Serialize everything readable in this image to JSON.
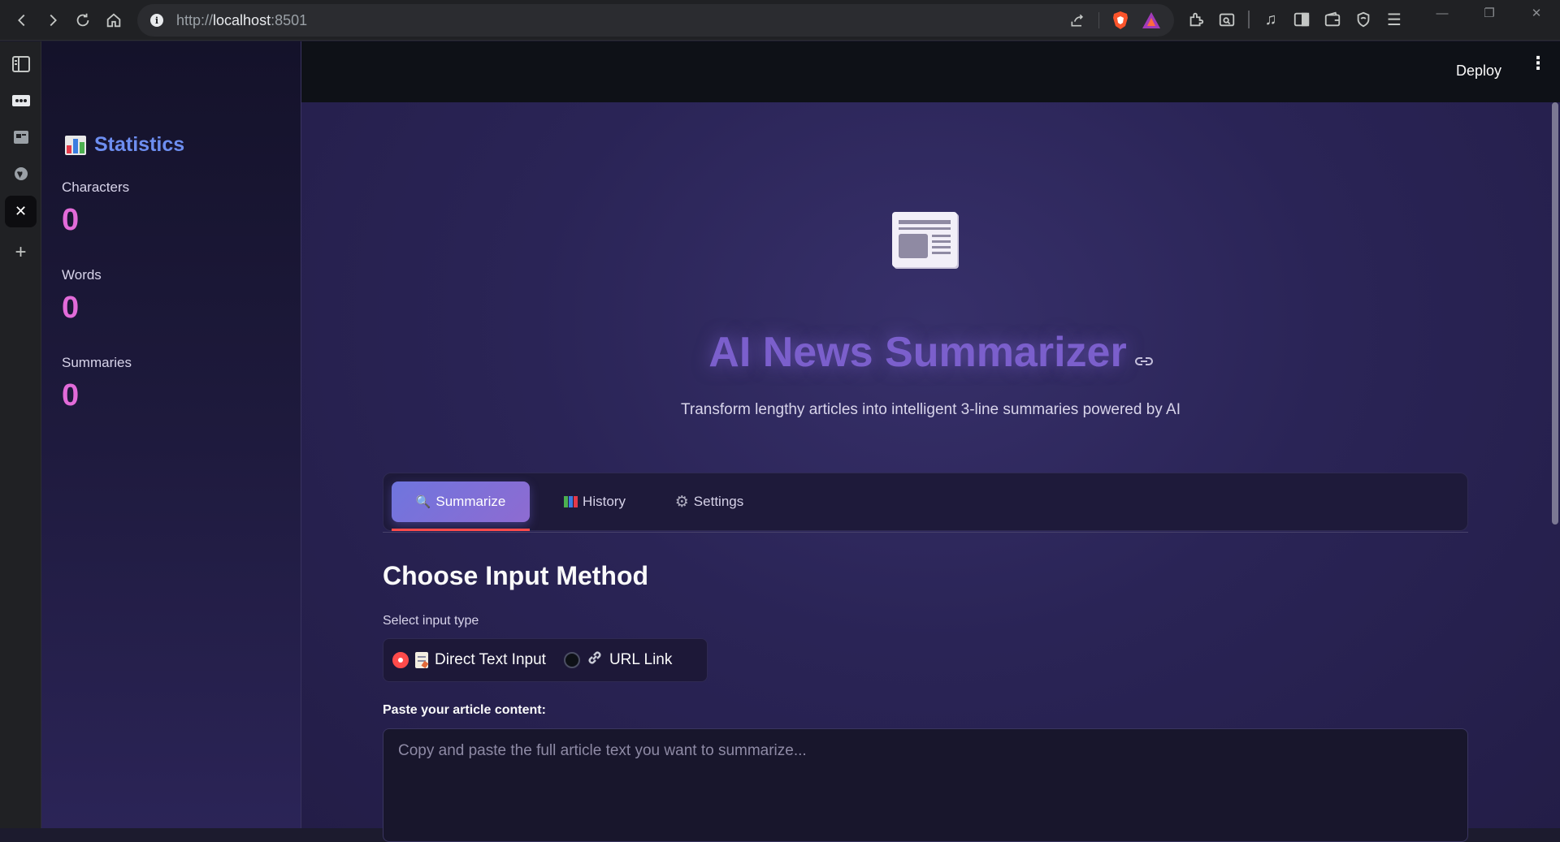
{
  "browser": {
    "url_scheme": "http://",
    "url_host": "localhost",
    "url_port": ":8501"
  },
  "sidebar": {
    "stats_title": "Statistics",
    "metrics": [
      {
        "label": "Characters",
        "value": "0"
      },
      {
        "label": "Words",
        "value": "0"
      },
      {
        "label": "Summaries",
        "value": "0"
      }
    ]
  },
  "header": {
    "deploy_label": "Deploy",
    "menu_glyph": "⋮"
  },
  "hero": {
    "title": "AI News Summarizer",
    "subtitle": "Transform lengthy articles into intelligent 3-line summaries powered by AI"
  },
  "tabs": [
    {
      "label": "Summarize",
      "icon": "magnifier-icon",
      "active": true
    },
    {
      "label": "History",
      "icon": "books-icon",
      "active": false
    },
    {
      "label": "Settings",
      "icon": "gear-icon",
      "active": false
    }
  ],
  "input": {
    "section_title": "Choose Input Method",
    "select_label": "Select input type",
    "options": [
      {
        "label": "Direct Text Input",
        "icon": "memo-icon",
        "checked": true
      },
      {
        "label": "URL Link",
        "icon": "link-icon",
        "checked": false
      }
    ],
    "paste_label": "Paste your article content:",
    "placeholder": "Copy and paste the full article text you want to summarize..."
  },
  "colors": {
    "accent": "#ff4b4b",
    "title": "#7b5fcc",
    "metric_value": "#e26bd9",
    "stats_title": "#6d8ef0"
  }
}
